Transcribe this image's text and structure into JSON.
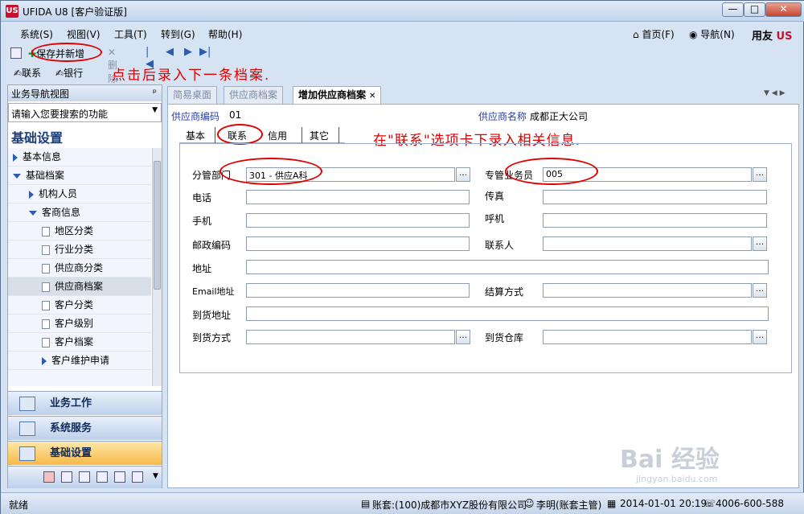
{
  "window": {
    "app_icon": "US",
    "title": "UFIDA U8 [客户验证版]"
  },
  "window_controls": {
    "minimize": "—",
    "maximize": "□",
    "close": "✕"
  },
  "menu": {
    "items": [
      "系统(S)",
      "视图(V)",
      "工具(T)",
      "转到(G)",
      "帮助(H)"
    ],
    "right": {
      "home": "首页(F)",
      "nav": "导航(N)",
      "brand": "用友"
    }
  },
  "toolbar": {
    "save_new": "保存并新增",
    "delete": "删除",
    "contact": "联系",
    "bank": "银行"
  },
  "annotations": {
    "a1": "点击后录入下一条档案.",
    "a2": "在\"联系\"选项卡下录入相关信息."
  },
  "sidebar": {
    "header": "业务导航视图",
    "pin": "ᵖ",
    "search_placeholder": "请输入您要搜索的功能",
    "title": "基础设置",
    "tree": [
      {
        "label": "基本信息"
      },
      {
        "label": "基础档案"
      },
      {
        "label": "机构人员"
      },
      {
        "label": "客商信息"
      },
      {
        "label": "地区分类"
      },
      {
        "label": "行业分类"
      },
      {
        "label": "供应商分类"
      },
      {
        "label": "供应商档案"
      },
      {
        "label": "客户分类"
      },
      {
        "label": "客户级别"
      },
      {
        "label": "客户档案"
      },
      {
        "label": "客户维护申请"
      }
    ],
    "nav": {
      "business": "业务工作",
      "system": "系统服务",
      "basic": "基础设置"
    }
  },
  "tabs": [
    "简易桌面",
    "供应商档案",
    "增加供应商档案"
  ],
  "form": {
    "code_label": "供应商编码",
    "code_value": "01",
    "name_label": "供应商名称",
    "name_value": "成都正大公司",
    "subtabs": [
      "基本",
      "联系",
      "信用",
      "其它"
    ],
    "fields": {
      "dept_label": "分管部门",
      "dept_value": "301 - 供应A科",
      "staff_label": "专管业务员",
      "staff_value": "005",
      "phone_label": "电话",
      "fax_label": "传真",
      "mobile_label": "手机",
      "pager_label": "呼机",
      "zip_label": "邮政编码",
      "contact_label": "联系人",
      "address_label": "地址",
      "email_label": "Email地址",
      "settle_label": "结算方式",
      "deliv_addr_label": "到货地址",
      "deliv_method_label": "到货方式",
      "deliv_wh_label": "到货仓库"
    },
    "ref_button": "..."
  },
  "statusbar": {
    "ready": "就绪",
    "account": "账套:(100)成都市XYZ股份有限公司",
    "user": "李明(账套主管)",
    "datetime": "2014-01-01 20:19",
    "phone": "4006-600-588"
  },
  "watermark": {
    "main": "Bai 经验",
    "sub": "jingyan.baidu.com"
  }
}
